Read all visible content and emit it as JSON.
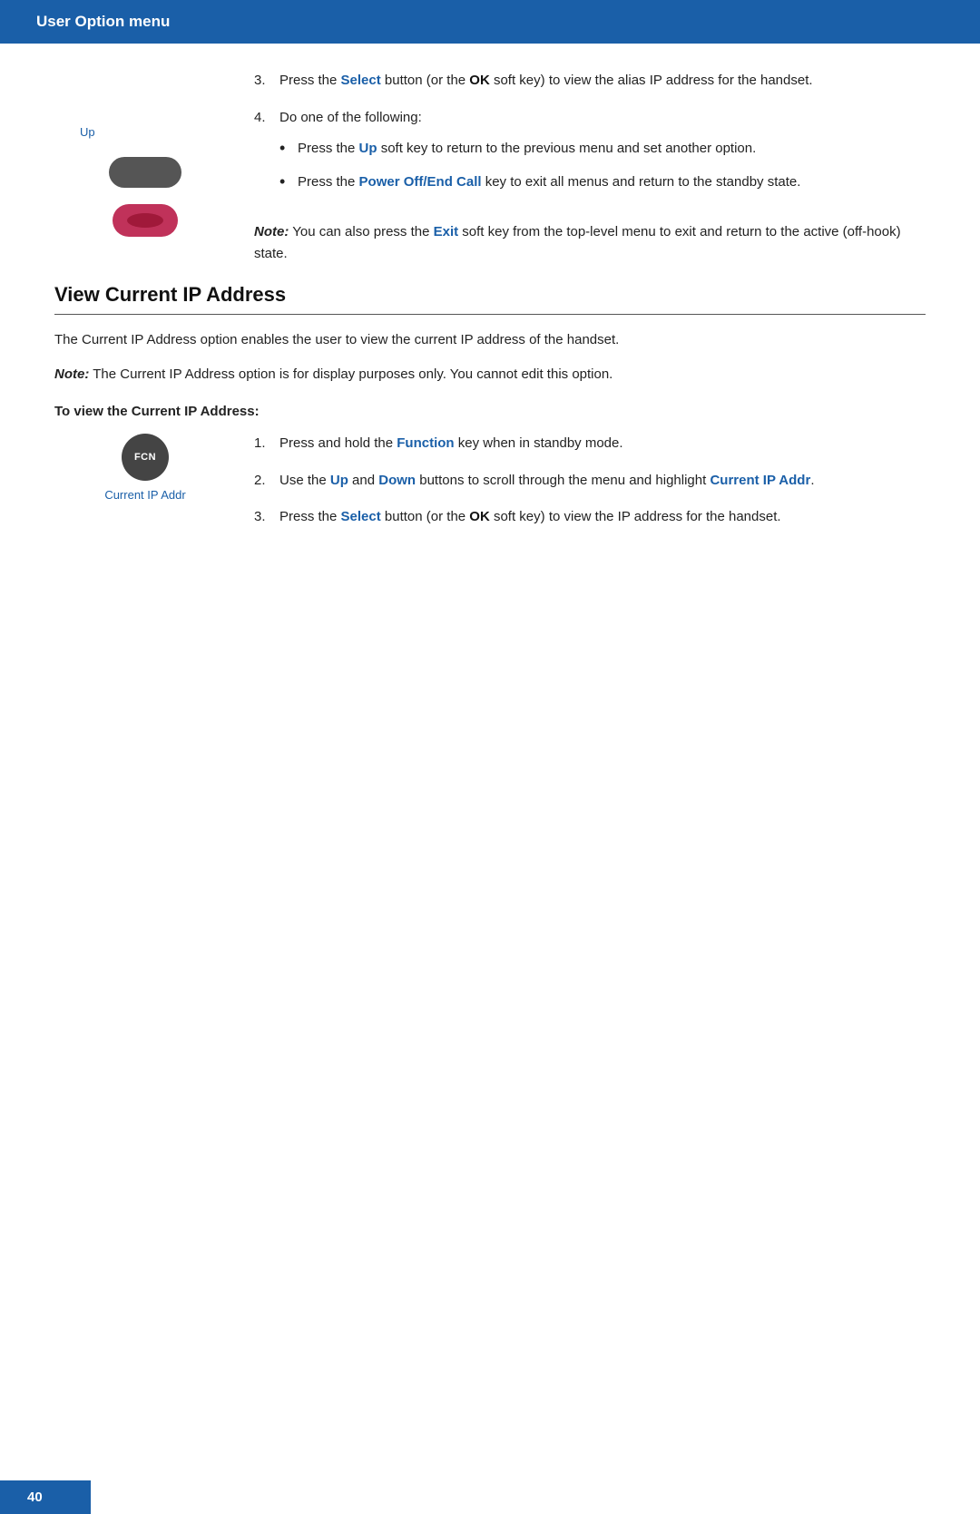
{
  "header": {
    "title": "User Option menu"
  },
  "top_section": {
    "up_label": "Up",
    "step3": {
      "num": "3.",
      "text_before_select": "Press the ",
      "select_word": "Select",
      "text_mid": " button (or the ",
      "ok_word": "OK",
      "text_after": " soft key) to view the alias IP address for the handset."
    },
    "step4": {
      "num": "4.",
      "text": "Do one of the following:"
    },
    "bullet1": {
      "text_before": "Press the ",
      "up_word": "Up",
      "text_after": " soft key to return to the previous menu and set another option."
    },
    "bullet2": {
      "text_before": "Press the ",
      "power_word": "Power Off/End Call",
      "text_after": " key to exit all menus and return to the standby state."
    },
    "note": {
      "label": "Note:",
      "text_before": " You can also press the ",
      "exit_word": "Exit",
      "text_after": " soft key from the top-level menu to exit and return to the active (off-hook) state."
    }
  },
  "section": {
    "heading": "View Current IP Address",
    "desc": "The Current IP Address option enables the user to view the current IP address of the handset.",
    "note": {
      "label": "Note:",
      "text": " The Current IP Address option is for display purposes only. You cannot edit this option."
    },
    "to_view_heading": "To view the Current IP Address:",
    "fcn_label": "FCN",
    "current_ip_label": "Current IP Addr",
    "step1": {
      "num": "1.",
      "text_before": "Press and hold the ",
      "function_word": "Function",
      "text_after": " key when in standby mode."
    },
    "step2": {
      "num": "2.",
      "text_before": "Use the ",
      "up_word": "Up",
      "text_mid1": " and ",
      "down_word": "Down",
      "text_mid2": " buttons to scroll through the menu and highlight ",
      "current_ip_word": "Current IP Addr",
      "text_after": "."
    },
    "step3": {
      "num": "3.",
      "text_before": "Press the ",
      "select_word": "Select",
      "text_mid": " button (or the ",
      "ok_word": "OK",
      "text_after": " soft key) to view the IP address for the handset."
    }
  },
  "footer": {
    "page_number": "40"
  }
}
